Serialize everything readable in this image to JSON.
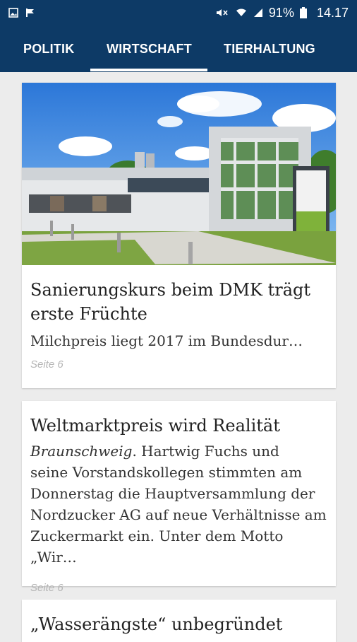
{
  "status_bar": {
    "battery_percent": "91%",
    "time": "14.17",
    "icons_left": [
      "image-icon",
      "flag-icon"
    ],
    "icons_right": [
      "mute-icon",
      "wifi-icon",
      "signal-icon",
      "battery-icon"
    ]
  },
  "tabs": [
    {
      "label": "POLITIK",
      "active": false
    },
    {
      "label": "WIRTSCHAFT",
      "active": true
    },
    {
      "label": "TIERHALTUNG",
      "active": false
    }
  ],
  "articles": [
    {
      "image": "building-photo",
      "title_line1": "Sanierungskurs beim DMK trägt",
      "title_line2": "erste Früchte",
      "excerpt": "Milchpreis liegt 2017 im Bundesdur…",
      "page": "Seite 6"
    },
    {
      "title": "Weltmarktpreis wird Realität",
      "location": "Braunschweig",
      "excerpt_line1_rest": ". Hartwig Fuchs und",
      "excerpt_line2": "seine Vorstandskollegen stimmten am",
      "excerpt_line3": "Donnerstag die Hauptversammlung der",
      "excerpt_line4": "Nordzucker AG auf neue Verhältnisse am",
      "excerpt_line5": "Zuckermarkt ein. Unter dem Motto „Wir…",
      "page": "Seite 6"
    },
    {
      "title": "„Wasserängste“ unbegründet"
    }
  ],
  "colors": {
    "header": "#0d3a66",
    "background": "#ececec"
  }
}
